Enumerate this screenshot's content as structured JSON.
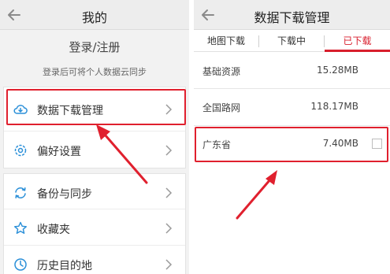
{
  "left_screen": {
    "title": "我的",
    "login": {
      "title": "登录/注册",
      "subtitle": "登录后可将个人数据云同步"
    },
    "menu": [
      {
        "label": "数据下载管理",
        "icon": "cloud-download-icon"
      },
      {
        "label": "偏好设置",
        "icon": "settings-icon"
      },
      {
        "label": "备份与同步",
        "icon": "sync-icon"
      },
      {
        "label": "收藏夹",
        "icon": "star-icon"
      },
      {
        "label": "历史目的地",
        "icon": "history-icon"
      }
    ]
  },
  "right_screen": {
    "title": "数据下载管理",
    "tabs": [
      {
        "label": "地图下载"
      },
      {
        "label": "下载中"
      },
      {
        "label": "已下载",
        "active": true
      }
    ],
    "items": [
      {
        "name": "基础资源",
        "size": "15.28MB"
      },
      {
        "name": "全国路网",
        "size": "118.17MB"
      },
      {
        "name": "广东省",
        "size": "7.40MB"
      }
    ]
  },
  "colors": {
    "accent": "#d81e2c",
    "highlight": "#e0202e",
    "icon_blue": "#2a8fd8"
  }
}
